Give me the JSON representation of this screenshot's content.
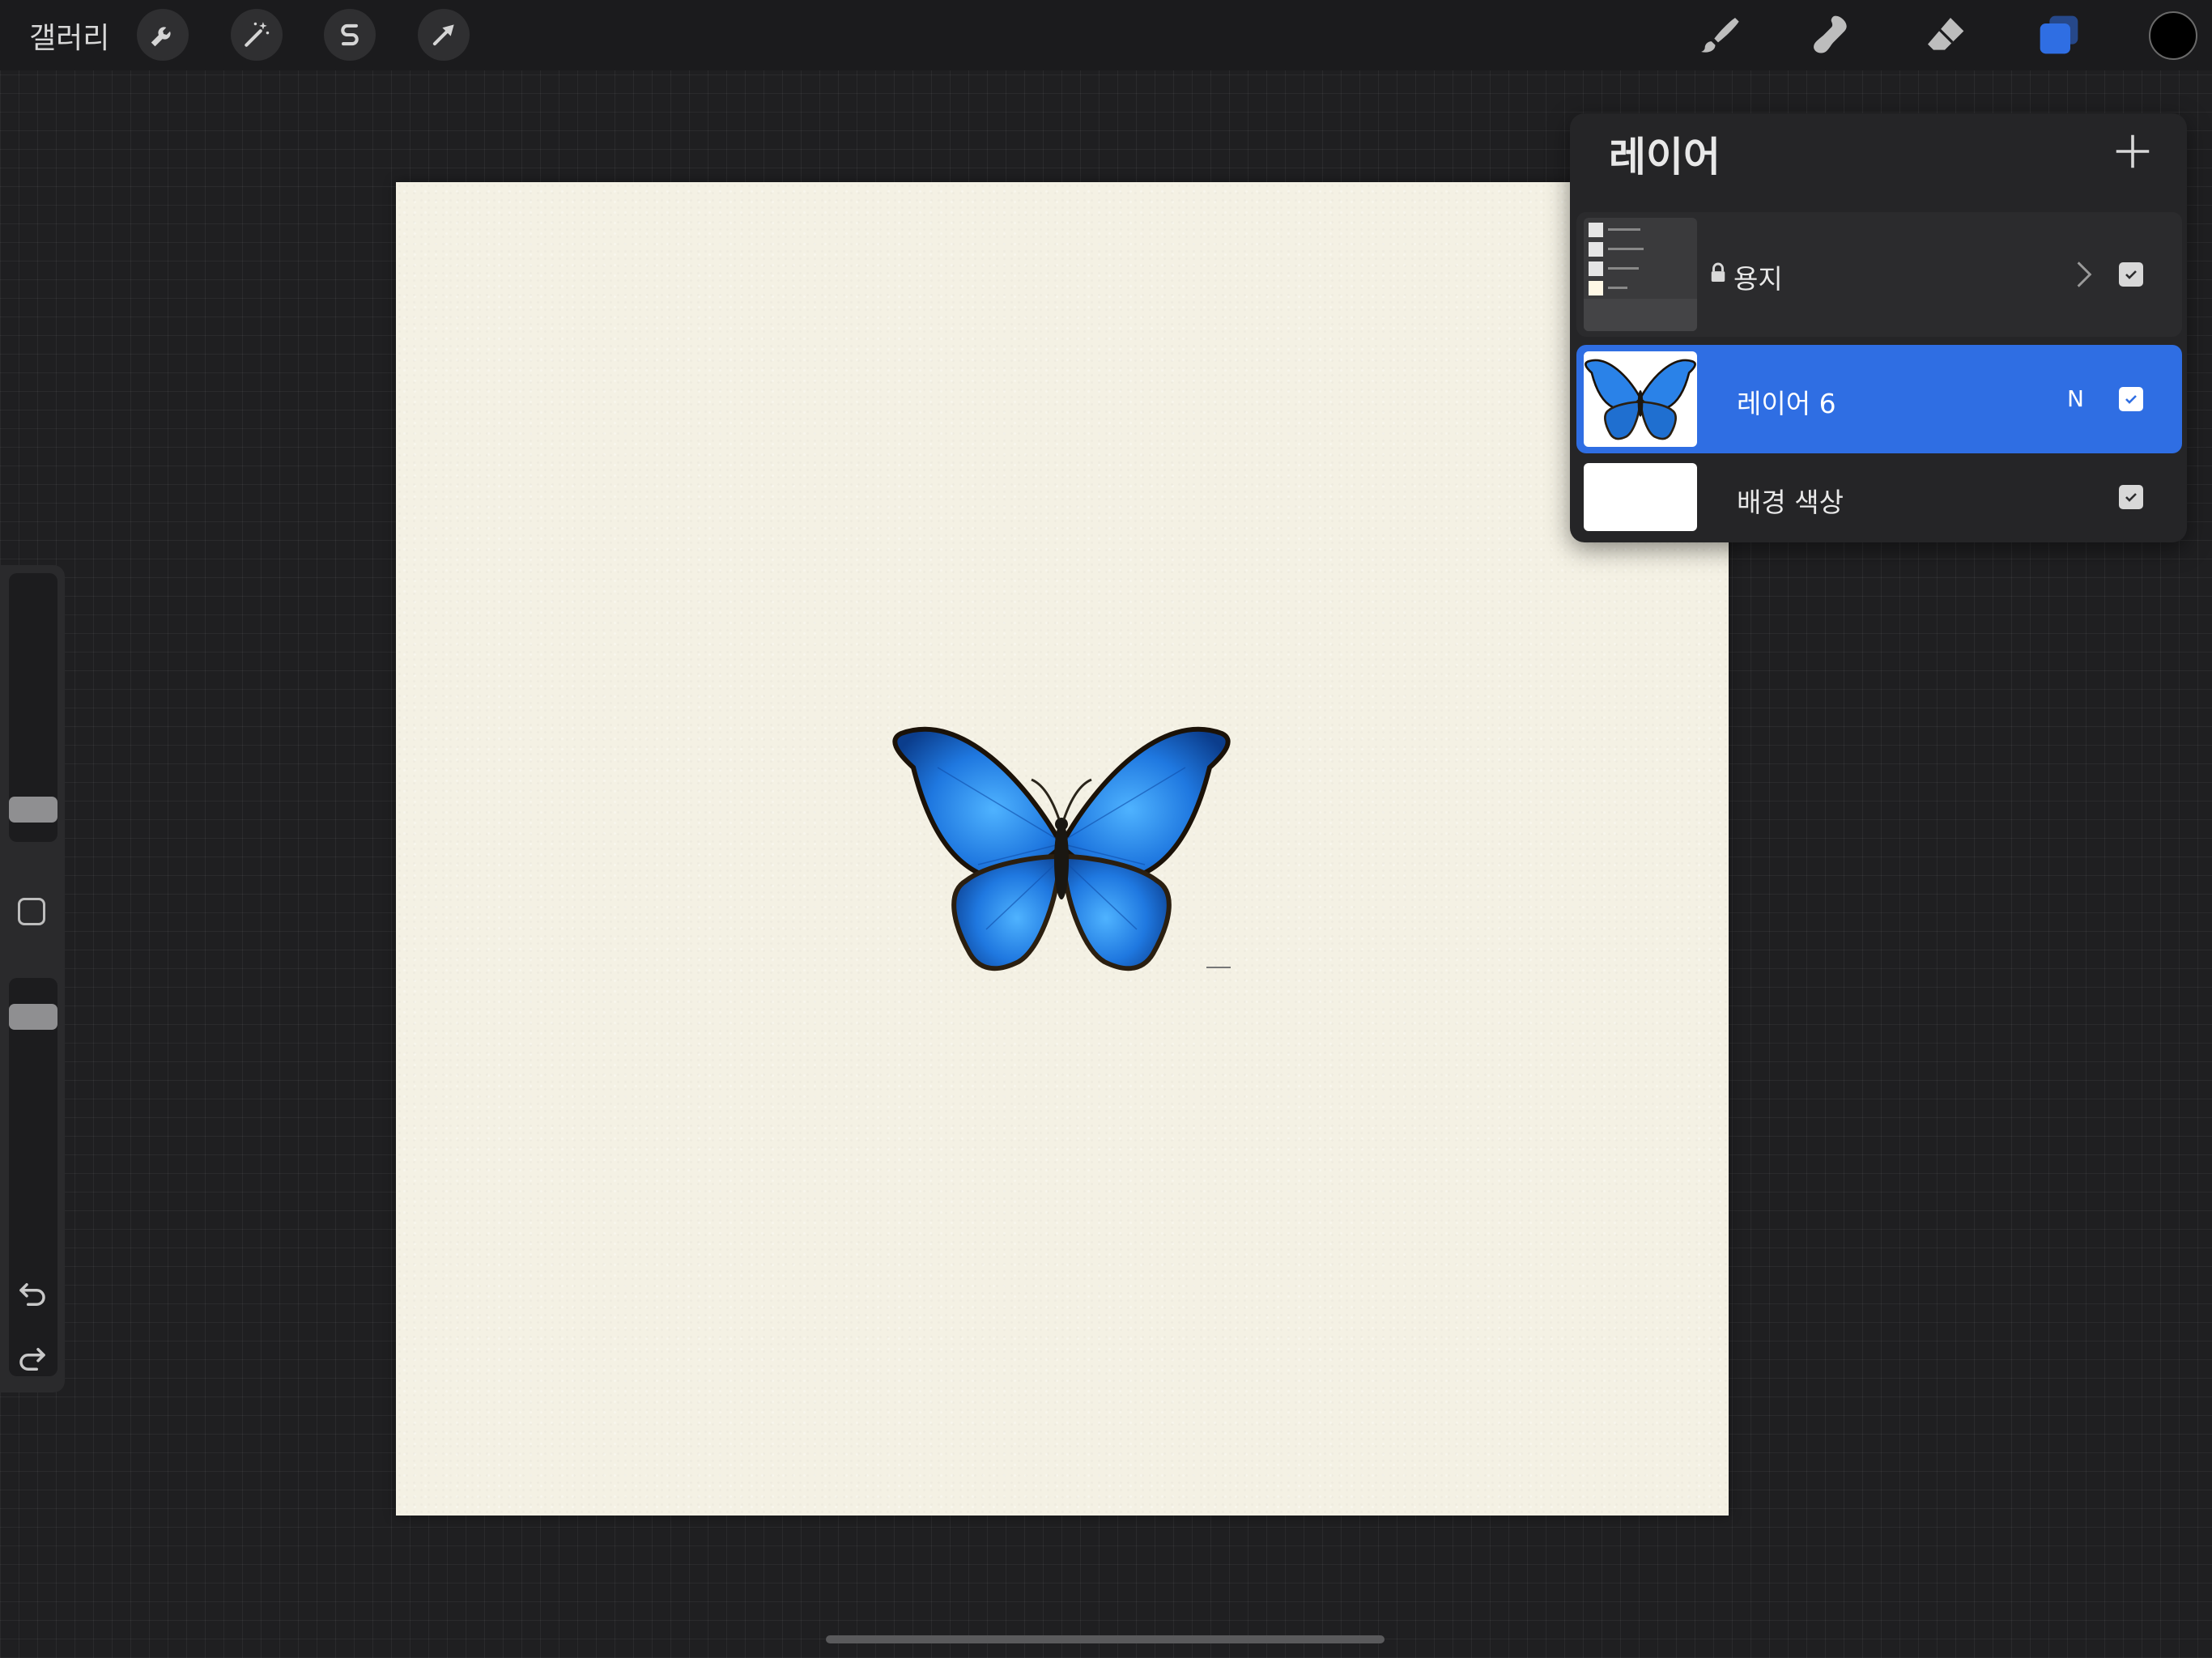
{
  "topbar": {
    "gallery_label": "갤러리",
    "left_tools": [
      "wrench-icon",
      "magic-wand-icon",
      "selection-s-icon",
      "move-arrow-icon"
    ],
    "right_tools": [
      "brush-icon",
      "smudge-icon",
      "eraser-icon",
      "layers-icon"
    ],
    "active_tool": "layers-icon",
    "current_color": "#000000",
    "accent_color": "#2f6ee3"
  },
  "layers_panel": {
    "title": "레이어",
    "layers": [
      {
        "name": "용지",
        "locked": true,
        "type": "group",
        "visible": true
      },
      {
        "name": "레이어 6",
        "blend_mode": "N",
        "active": true,
        "visible": true
      },
      {
        "name": "배경 색상",
        "visible": true
      }
    ]
  },
  "sidebar": {
    "brush_size_fraction": 0.08,
    "opacity_fraction": 0.93
  }
}
